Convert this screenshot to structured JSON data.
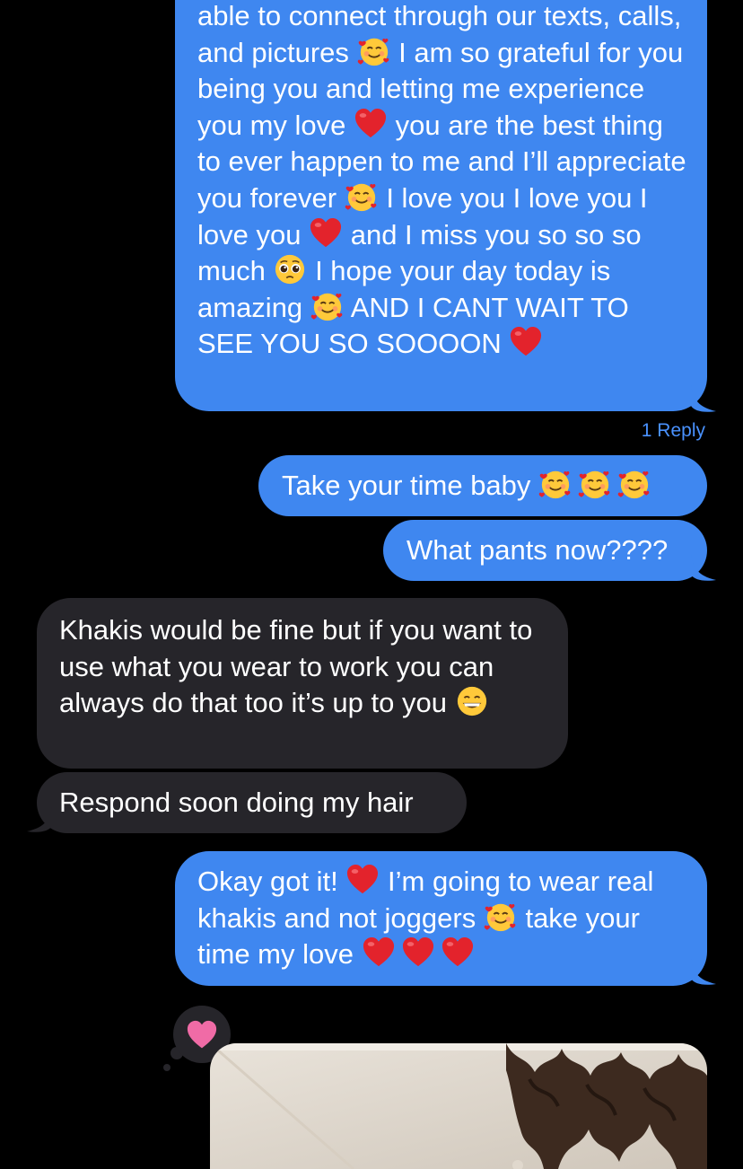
{
  "messages": [
    {
      "id": "b1",
      "direction": "sent",
      "text_parts": [
        "able to connect through our texts, calls, and pictures",
        "I am so grateful for you being you and letting me experience you my love",
        "you are the best thing to ever happen to me and I’ll appreciate you forever",
        "I love you I love you I love you",
        "and I miss you so so so much",
        "I hope your day today is amazing",
        "AND I CANT WAIT TO SEE YOU SO SOOOON"
      ],
      "emojis": [
        "smiling-face-with-hearts",
        "red-heart",
        "smiling-face-with-hearts",
        "red-heart",
        "pleading-face",
        "smiling-face-with-hearts",
        "red-heart"
      ]
    },
    {
      "id": "b2",
      "direction": "sent",
      "text": "Take your time baby",
      "emojis": [
        "smiling-face-with-hearts",
        "smiling-face-with-hearts",
        "smiling-face-with-hearts"
      ]
    },
    {
      "id": "b3",
      "direction": "sent",
      "text": "What pants now????"
    },
    {
      "id": "b4",
      "direction": "received",
      "text": "Khakis would be fine but if you want to use what you wear to work you can always do that too it’s up to you",
      "emojis": [
        "grinning-face-with-smiling-eyes"
      ]
    },
    {
      "id": "b5",
      "direction": "received",
      "text": "Respond soon doing my hair"
    },
    {
      "id": "b6",
      "direction": "sent",
      "text_parts": [
        "Okay got it!",
        "I’m going to wear real khakis and not joggers",
        "take your time my love"
      ],
      "emojis": [
        "red-heart",
        "smiling-face-with-hearts",
        "red-heart",
        "red-heart",
        "red-heart"
      ]
    }
  ],
  "reply_count_label": "1 Reply",
  "tapback": {
    "icon": "heart-icon",
    "color": "#f06ba6"
  },
  "attachment": {
    "type": "image",
    "description_icon": "photo-thumbnail"
  },
  "colors": {
    "sent_bubble": "#3f87f0",
    "received_bubble": "#26252a",
    "background": "#000000",
    "link": "#4a92ff"
  }
}
